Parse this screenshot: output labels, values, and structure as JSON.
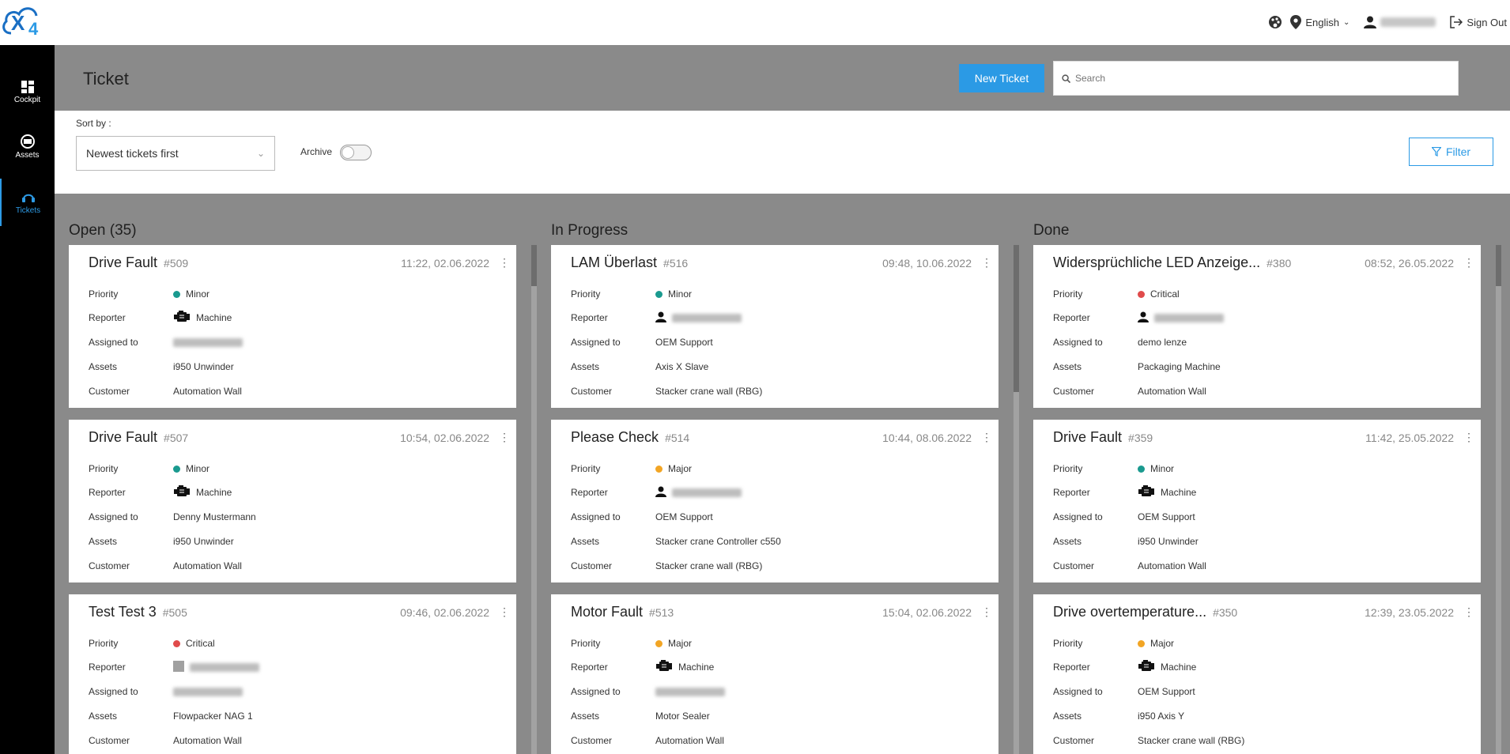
{
  "topbar": {
    "language": "English",
    "sign_out": "Sign Out"
  },
  "sidebar": {
    "items": [
      {
        "label": "Cockpit"
      },
      {
        "label": "Assets"
      },
      {
        "label": "Tickets"
      }
    ]
  },
  "header": {
    "title": "Ticket",
    "new_ticket": "New Ticket",
    "search_placeholder": "Search"
  },
  "filters": {
    "sort_label": "Sort by :",
    "sort_value": "Newest tickets first",
    "archive_label": "Archive",
    "archive_on": false,
    "filter_button": "Filter"
  },
  "colors": {
    "accent": "#2b9ae5",
    "minor": "#1a9a8f",
    "major": "#f2a524",
    "critical": "#e04b4b"
  },
  "field_labels": {
    "priority": "Priority",
    "reporter": "Reporter",
    "assigned": "Assigned to",
    "assets": "Assets",
    "customer": "Customer"
  },
  "columns": [
    {
      "title": "Open (35)",
      "cards": [
        {
          "title": "Drive Fault",
          "number": "#509",
          "time": "11:22, 02.06.2022",
          "priority": "Minor",
          "priority_level": "minor",
          "reporter": "Machine",
          "reporter_type": "machine",
          "assigned": "",
          "assigned_blurred": true,
          "assets": "i950 Unwinder",
          "customer": "Automation Wall"
        },
        {
          "title": "Drive Fault",
          "number": "#507",
          "time": "10:54, 02.06.2022",
          "priority": "Minor",
          "priority_level": "minor",
          "reporter": "Machine",
          "reporter_type": "machine",
          "assigned": "Denny Mustermann",
          "assigned_blurred": false,
          "assets": "i950 Unwinder",
          "customer": "Automation Wall"
        },
        {
          "title": "Test Test 3",
          "number": "#505",
          "time": "09:46, 02.06.2022",
          "priority": "Critical",
          "priority_level": "critical",
          "reporter": "",
          "reporter_type": "user-blurred",
          "assigned": "",
          "assigned_blurred": true,
          "assets": "Flowpacker NAG 1",
          "customer": "Automation Wall"
        }
      ]
    },
    {
      "title": "In Progress",
      "cards": [
        {
          "title": "LAM Überlast",
          "number": "#516",
          "time": "09:48, 10.06.2022",
          "priority": "Minor",
          "priority_level": "minor",
          "reporter": "",
          "reporter_type": "user",
          "assigned": "OEM Support",
          "assigned_blurred": false,
          "assets": "Axis X Slave",
          "customer": "Stacker crane wall (RBG)"
        },
        {
          "title": "Please Check",
          "number": "#514",
          "time": "10:44, 08.06.2022",
          "priority": "Major",
          "priority_level": "major",
          "reporter": "",
          "reporter_type": "user",
          "assigned": "OEM Support",
          "assigned_blurred": false,
          "assets": "Stacker crane Controller c550",
          "customer": "Stacker crane wall (RBG)"
        },
        {
          "title": "Motor Fault",
          "number": "#513",
          "time": "15:04, 02.06.2022",
          "priority": "Major",
          "priority_level": "major",
          "reporter": "Machine",
          "reporter_type": "machine",
          "assigned": "",
          "assigned_blurred": true,
          "assets": "Motor Sealer",
          "customer": "Automation Wall"
        }
      ]
    },
    {
      "title": "Done",
      "cards": [
        {
          "title": "Widersprüchliche LED Anzeige...",
          "number": "#380",
          "time": "08:52, 26.05.2022",
          "priority": "Critical",
          "priority_level": "critical",
          "reporter": "",
          "reporter_type": "user",
          "assigned": "demo lenze",
          "assigned_blurred": false,
          "assets": "Packaging Machine",
          "customer": "Automation Wall"
        },
        {
          "title": "Drive Fault",
          "number": "#359",
          "time": "11:42, 25.05.2022",
          "priority": "Minor",
          "priority_level": "minor",
          "reporter": "Machine",
          "reporter_type": "machine",
          "assigned": "OEM Support",
          "assigned_blurred": false,
          "assets": "i950 Unwinder",
          "customer": "Automation Wall"
        },
        {
          "title": "Drive overtemperature...",
          "number": "#350",
          "time": "12:39, 23.05.2022",
          "priority": "Major",
          "priority_level": "major",
          "reporter": "Machine",
          "reporter_type": "machine",
          "assigned": "OEM Support",
          "assigned_blurred": false,
          "assets": "i950 Axis Y",
          "customer": "Stacker crane wall (RBG)"
        }
      ]
    }
  ]
}
